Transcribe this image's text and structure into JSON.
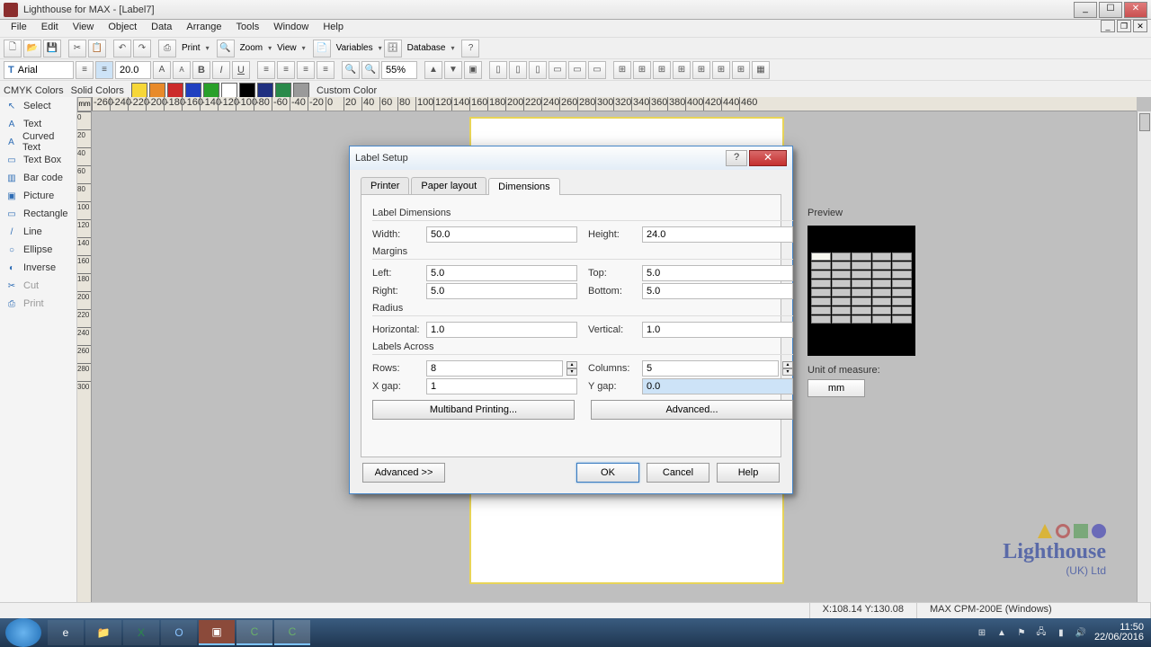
{
  "window": {
    "title": "Lighthouse for MAX - [Label7]"
  },
  "menus": [
    "File",
    "Edit",
    "View",
    "Object",
    "Data",
    "Arrange",
    "Tools",
    "Window",
    "Help"
  ],
  "toolbar1": {
    "print": "Print",
    "zoom": "Zoom",
    "view": "View",
    "variables": "Variables",
    "database": "Database"
  },
  "font": {
    "name": "Arial",
    "size": "20.0"
  },
  "zoom": {
    "value": "55%"
  },
  "colorbar": {
    "cmyk": "CMYK Colors",
    "solid": "Solid Colors",
    "custom": "Custom Color"
  },
  "swatches": [
    "#f6d738",
    "#e88a2a",
    "#cc2b2b",
    "#2040c0",
    "#2aa02a",
    "#ffffff",
    "#000000",
    "#203080",
    "#2a8a4a",
    "#9a9a9a"
  ],
  "tools": [
    {
      "label": "Select",
      "icon": "↖"
    },
    {
      "label": "Text",
      "icon": "A"
    },
    {
      "label": "Curved Text",
      "icon": "A"
    },
    {
      "label": "Text Box",
      "icon": "▭"
    },
    {
      "label": "Bar code",
      "icon": "▥"
    },
    {
      "label": "Picture",
      "icon": "▣"
    },
    {
      "label": "Rectangle",
      "icon": "▭"
    },
    {
      "label": "Line",
      "icon": "/"
    },
    {
      "label": "Ellipse",
      "icon": "○"
    },
    {
      "label": "Inverse",
      "icon": "◐"
    },
    {
      "label": "Cut",
      "icon": "✂",
      "disabled": true
    },
    {
      "label": "Print",
      "icon": "⎙",
      "disabled": true
    }
  ],
  "ruler": {
    "unit": "mm"
  },
  "dialog": {
    "title": "Label Setup",
    "tabs": [
      "Printer",
      "Paper layout",
      "Dimensions"
    ],
    "active_tab": 2,
    "groups": {
      "labeldim": "Label Dimensions",
      "margins": "Margins",
      "radius": "Radius",
      "across": "Labels Across"
    },
    "fields": {
      "width_l": "Width:",
      "width_v": "50.0",
      "height_l": "Height:",
      "height_v": "24.0",
      "left_l": "Left:",
      "left_v": "5.0",
      "top_l": "Top:",
      "top_v": "5.0",
      "right_l": "Right:",
      "right_v": "5.0",
      "bottom_l": "Bottom:",
      "bottom_v": "5.0",
      "hrad_l": "Horizontal:",
      "hrad_v": "1.0",
      "vrad_l": "Vertical:",
      "vrad_v": "1.0",
      "rows_l": "Rows:",
      "rows_v": "8",
      "cols_l": "Columns:",
      "cols_v": "5",
      "xgap_l": "X gap:",
      "xgap_v": "1",
      "ygap_l": "Y gap:",
      "ygap_v": "0.0"
    },
    "buttons": {
      "multiband": "Multiband Printing...",
      "advanced": "Advanced...",
      "advanced_toggle": "Advanced >>",
      "ok": "OK",
      "cancel": "Cancel",
      "help": "Help"
    },
    "preview": {
      "label": "Preview",
      "uom_label": "Unit of measure:",
      "uom": "mm"
    }
  },
  "status": {
    "coords": "X:108.14 Y:130.08",
    "printer": "MAX CPM-200E (Windows)"
  },
  "logo": {
    "name": "Lighthouse",
    "sub": "(UK) Ltd"
  },
  "tray": {
    "time": "11:50",
    "date": "22/06/2016"
  }
}
